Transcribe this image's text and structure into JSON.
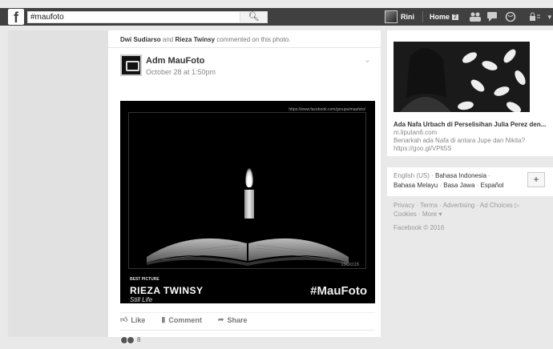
{
  "topbar": {
    "logo": "f",
    "search_value": "#maufoto",
    "search_icon": "search-icon",
    "user_name": "Rini",
    "home_label": "Home",
    "home_count": "2"
  },
  "story": {
    "actor1": "Dwi Sudiarso",
    "and": " and ",
    "actor2": "Rieza Twinsy",
    "action": " commented on this photo."
  },
  "post": {
    "page_name": "Adm MauFoto",
    "date": "October 28 at 1:50pm",
    "photo": {
      "url": "https://www.facebook.com/groups/maufoto/",
      "date": "19Oct16",
      "best": "BEST PICTURE",
      "winner": "RIEZA TWINSY",
      "title": "Still Life",
      "hashtag": "#MauFoto"
    },
    "actions": {
      "like": "Like",
      "comment": "Comment",
      "share": "Share"
    },
    "reaction_count": "8"
  },
  "ad": {
    "title": "Ada Nafa Urbach di Perselisihan Julia Perez den...",
    "domain": "m.liputan6.com",
    "description": "Benarkah ada Nafa di antara Jupe dan Nikita? https://goo.gl/VPlt5S"
  },
  "languages": {
    "current": "English (US)",
    "l1": "Bahasa Indonesia",
    "l2": "Bahasa Melayu",
    "l3": "Basa Jawa",
    "l4": "Español",
    "sep": " · ",
    "plus": "+"
  },
  "footer": {
    "line1": "Privacy · Terms · Advertising · Ad Choices ▷",
    "line2": "Cookies · More ▾",
    "copyright": "Facebook © 2016"
  }
}
